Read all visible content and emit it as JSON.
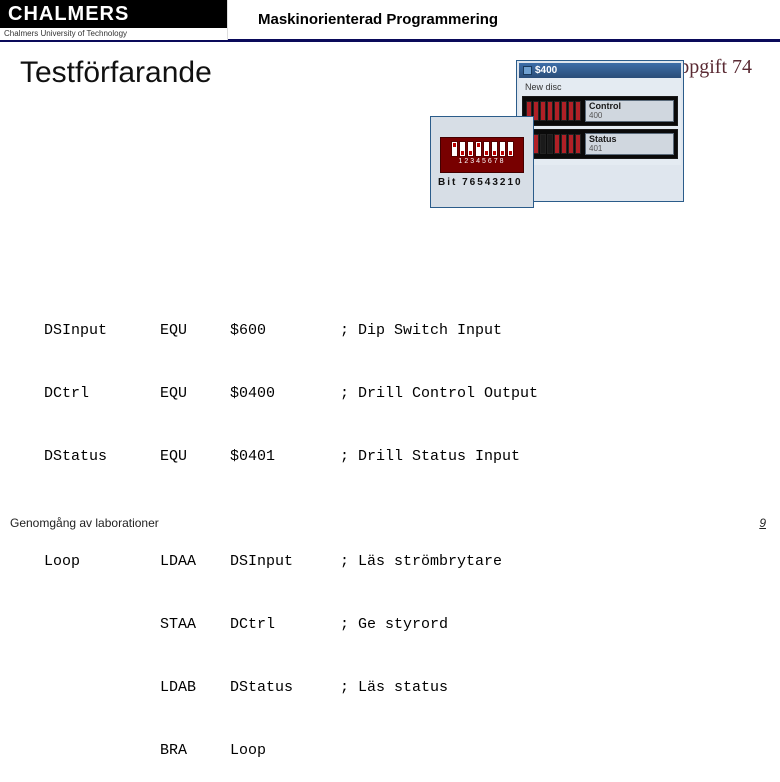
{
  "header": {
    "logo_text": "CHALMERS",
    "logo_sub": "Chalmers University of Technology",
    "course": "Maskinorienterad Programmering"
  },
  "title": "Testförfarande",
  "task_label": "Uppgift 74",
  "dip": {
    "caption": "Bit 76543210",
    "digits": "12345678"
  },
  "window": {
    "address": "$400",
    "tab": "New disc",
    "rows": [
      {
        "label": "Control",
        "sub": "400"
      },
      {
        "label": "Status",
        "sub": "401"
      }
    ]
  },
  "code": {
    "rows": [
      {
        "c1": "DSInput",
        "c2": "EQU",
        "c3": "$600",
        "c4": "; Dip Switch Input"
      },
      {
        "c1": "DCtrl",
        "c2": "EQU",
        "c3": "$0400",
        "c4": "; Drill Control Output"
      },
      {
        "c1": "DStatus",
        "c2": "EQU",
        "c3": "$0401",
        "c4": "; Drill Status Input"
      },
      {
        "c1": "",
        "c2": "",
        "c3": "",
        "c4": ""
      },
      {
        "c1": "Loop",
        "c2": "LDAA",
        "c3": "DSInput",
        "c4": "; Läs strömbrytare"
      },
      {
        "c1": "",
        "c2": "STAA",
        "c3": "DCtrl",
        "c4": "; Ge styrord"
      },
      {
        "c1": "",
        "c2": "LDAB",
        "c3": "DStatus",
        "c4": "; Läs status"
      },
      {
        "c1": "",
        "c2": "BRA",
        "c3": "Loop",
        "c4": ""
      }
    ]
  },
  "footer": {
    "left": "Genomgång av laborationer",
    "page": "9"
  }
}
